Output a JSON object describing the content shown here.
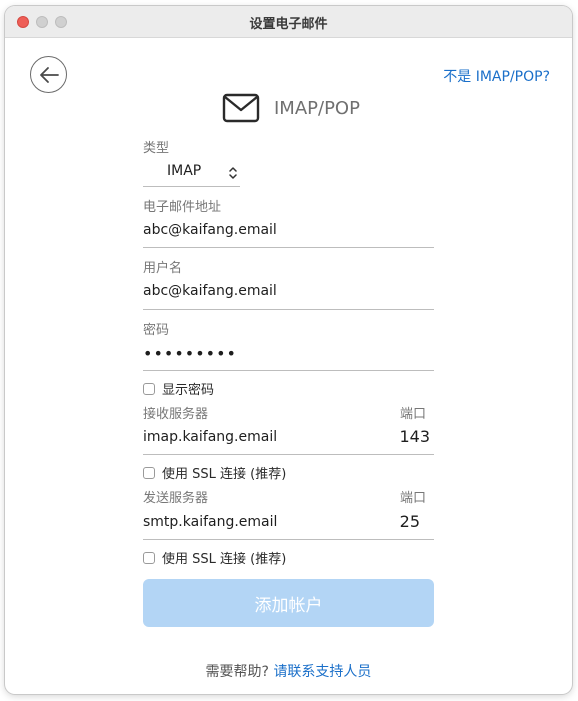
{
  "window": {
    "title": "设置电子邮件"
  },
  "nav": {
    "back_icon": "arrow-left-icon",
    "not_imap_link": "不是 IMAP/POP?"
  },
  "header": {
    "icon": "envelope-icon",
    "title": "IMAP/POP"
  },
  "form": {
    "type_label": "类型",
    "type_value": "IMAP",
    "email_label": "电子邮件地址",
    "email_value": "abc@kaifang.email",
    "username_label": "用户名",
    "username_value": "abc@kaifang.email",
    "password_label": "密码",
    "password_value": "•••••••••",
    "show_password_label": "显示密码",
    "incoming_server_label": "接收服务器",
    "incoming_server_value": "imap.kaifang.email",
    "incoming_port_label": "端口",
    "incoming_port_value": "143",
    "incoming_ssl_label": "使用 SSL 连接 (推荐)",
    "outgoing_server_label": "发送服务器",
    "outgoing_server_value": "smtp.kaifang.email",
    "outgoing_port_label": "端口",
    "outgoing_port_value": "25",
    "outgoing_ssl_label": "使用 SSL 连接 (推荐)",
    "submit_label": "添加帐户"
  },
  "help": {
    "question": "需要帮助?",
    "link": "请联系支持人员"
  },
  "colors": {
    "accent": "#1a6fc9",
    "button_disabled": "#b3d5f5",
    "close_button": "#ee5e57"
  }
}
